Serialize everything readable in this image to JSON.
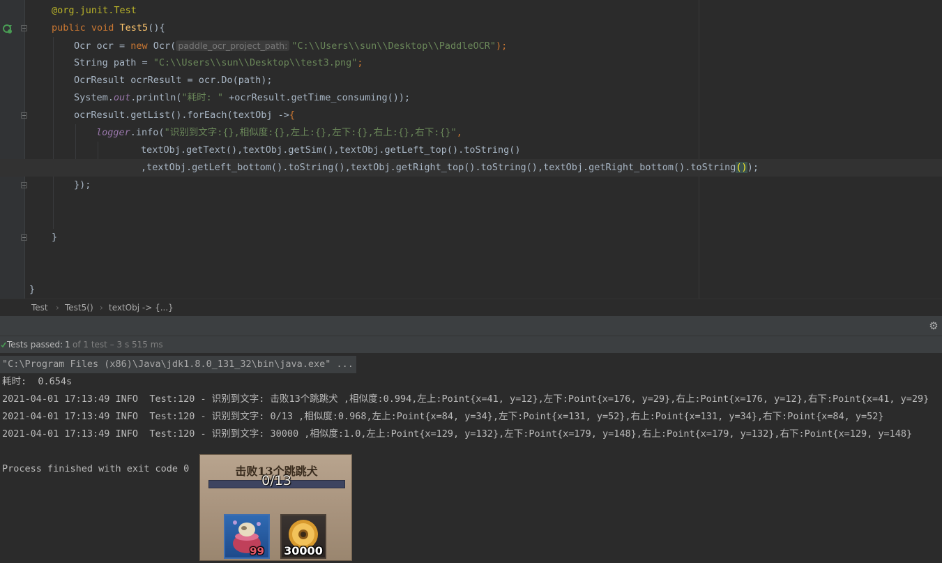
{
  "editor": {
    "annotation": "@org.junit.Test",
    "method_sig": {
      "kw": "public void ",
      "name": "Test5",
      "rest": "(){"
    },
    "line_ocr": {
      "a": "Ocr ocr = ",
      "kw": "new",
      "b": " Ocr(",
      "hint": "paddle_ocr_project_path:",
      "str": "\"C:\\\\Users\\\\sun\\\\Desktop\\\\PaddleOCR\"",
      "end": ");"
    },
    "line_path": {
      "a": "String path = ",
      "str": "\"C:\\\\Users\\\\sun\\\\Desktop\\\\test3.png\"",
      "end": ";"
    },
    "line_result": "OcrResult ocrResult = ocr.Do(path);",
    "line_print": {
      "a": "System.",
      "fld": "out",
      "b": ".println(",
      "str": "\"耗时: \"",
      "c": " +ocrResult.getTime_consuming());"
    },
    "line_foreach": {
      "a": "ocrResult.getList().forEach(textObj ->",
      "b": "{"
    },
    "line_logger": {
      "ivar": "logger",
      "a": ".info(",
      "str": "\"识别到文字:{},相似度:{},左上:{},左下:{},右上:{},右下:{}\"",
      "b": ","
    },
    "line_args1": "textObj.getText(),textObj.getSim(),textObj.getLeft_top().toString()",
    "line_args2": {
      "a": ",textObj.getLeft_bottom().toString(),textObj.getRight_top().toString(),textObj.getRight_bottom().toString",
      "paren": "()",
      "end": ");"
    },
    "line_close_lambda": "});",
    "line_close_method": "}",
    "line_close_class": "}"
  },
  "breadcrumb": {
    "items": [
      "Test",
      "Test5()",
      "textObj -> {...}"
    ],
    "sep": "›"
  },
  "run_panel": {
    "status_passed": "Tests passed:",
    "status_count": "1",
    "status_detail": "of 1 test – 3 s 515 ms",
    "gear_icon": "⚙"
  },
  "console": {
    "command": "\"C:\\Program Files (x86)\\Java\\jdk1.8.0_131_32\\bin\\java.exe\" ...",
    "time_line": "耗时:  0.654s",
    "log_lines": [
      "2021-04-01 17:13:49 INFO  Test:120 - 识别到文字: 击败13个跳跳犬 ,相似度:0.994,左上:Point{x=41, y=12},左下:Point{x=176, y=29},右上:Point{x=176, y=12},右下:Point{x=41, y=29}",
      "2021-04-01 17:13:49 INFO  Test:120 - 识别到文字: 0/13 ,相似度:0.968,左上:Point{x=84, y=34},左下:Point{x=131, y=52},右上:Point{x=131, y=34},右下:Point{x=84, y=52}",
      "2021-04-01 17:13:49 INFO  Test:120 - 识别到文字: 30000 ,相似度:1.0,左上:Point{x=129, y=132},左下:Point{x=179, y=148},右上:Point{x=179, y=132},右下:Point{x=129, y=148}"
    ],
    "exit_line": "Process finished with exit code 0"
  },
  "game_image": {
    "title": "击败13个跳跳犬",
    "progress": "0/13",
    "slot1_qty": "99",
    "slot2_qty": "30000"
  }
}
